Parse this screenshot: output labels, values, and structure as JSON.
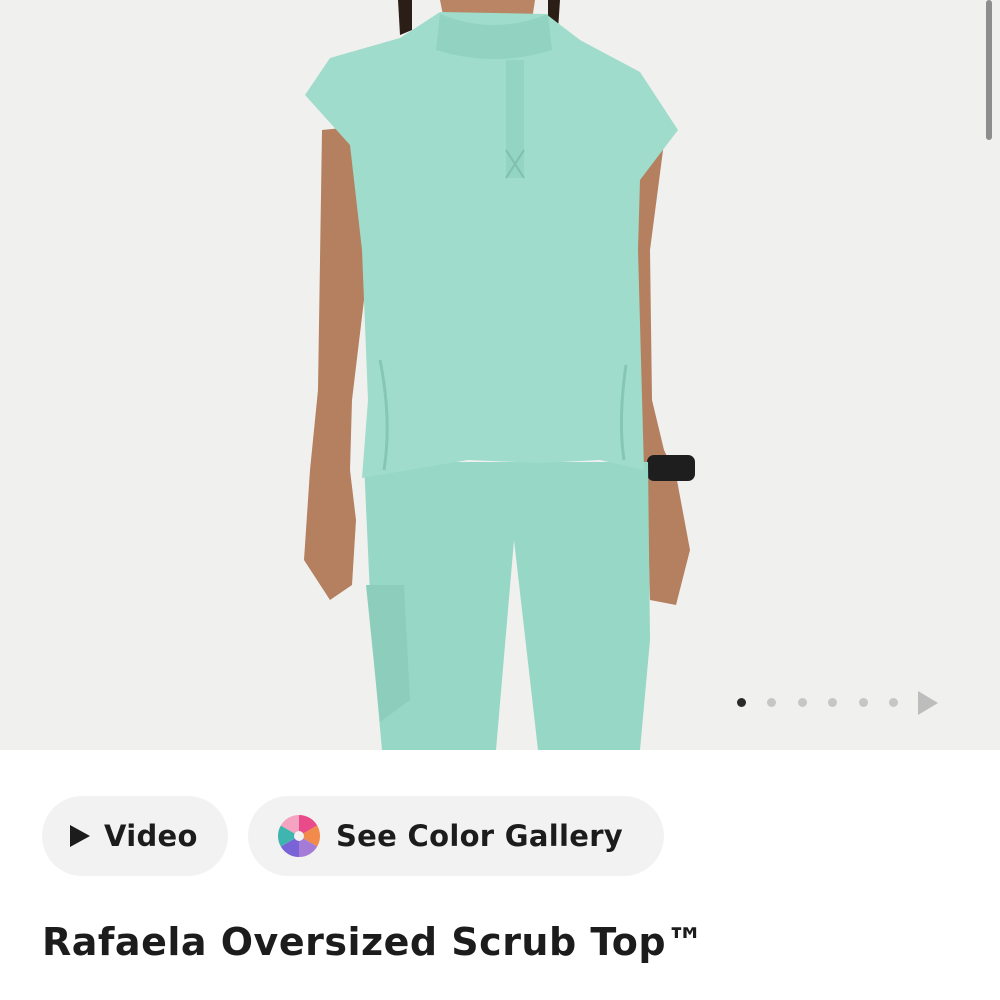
{
  "product": {
    "title": "Rafaela Oversized Scrub Top™",
    "garment_color": "#9fdccb"
  },
  "gallery": {
    "slide_count": 6,
    "active_index": 0
  },
  "actions": {
    "video_label": "Video",
    "color_gallery_label": "See Color Gallery"
  },
  "icons": {
    "video": "play-icon",
    "color_gallery": "color-wheel-icon",
    "next": "next-arrow-icon"
  }
}
